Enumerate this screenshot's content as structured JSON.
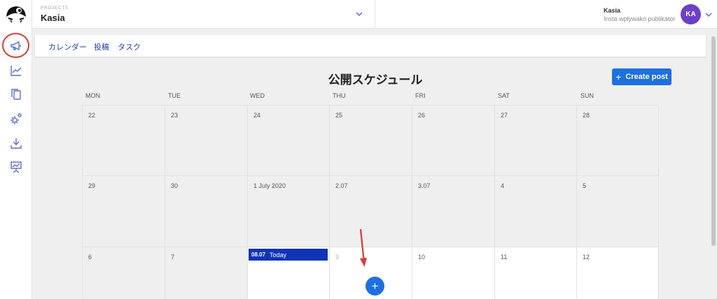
{
  "header": {
    "project_caption": "PROJECTS",
    "project_name": "Kasia",
    "user_name": "Kasia",
    "user_subtitle": "Insta wpływako publikator",
    "avatar_initials": "KA"
  },
  "sidebar": {
    "items": [
      {
        "icon": "megaphone-icon",
        "active": true
      },
      {
        "icon": "chart-line-icon"
      },
      {
        "icon": "copy-icon"
      },
      {
        "icon": "settings-cog-icon"
      },
      {
        "icon": "download-tray-icon"
      },
      {
        "icon": "presentation-board-icon"
      }
    ]
  },
  "tabs": [
    {
      "label": "カレンダー"
    },
    {
      "label": "投稿"
    },
    {
      "label": "タスク"
    }
  ],
  "calendar": {
    "title": "公開スケジュール",
    "create_button": "Create post",
    "weekdays": [
      "MON",
      "TUE",
      "WED",
      "THU",
      "FRI",
      "SAT",
      "SUN"
    ],
    "weeks": [
      [
        "22",
        "23",
        "24",
        "25",
        "26",
        "27",
        "28"
      ],
      [
        "29",
        "30",
        "1 July 2020",
        "2.07",
        "3.07",
        "4",
        "5"
      ],
      [
        "6",
        "7",
        "",
        "9",
        "10",
        "11",
        "12"
      ]
    ],
    "today_date": "08.07",
    "today_label": "Today",
    "add_button": "+"
  },
  "colors": {
    "accent": "#1e6fe0",
    "today": "#1034b8",
    "avatar": "#6c3fc8",
    "tab_text": "#1f3ea8",
    "annotation": "#d83a3a"
  }
}
